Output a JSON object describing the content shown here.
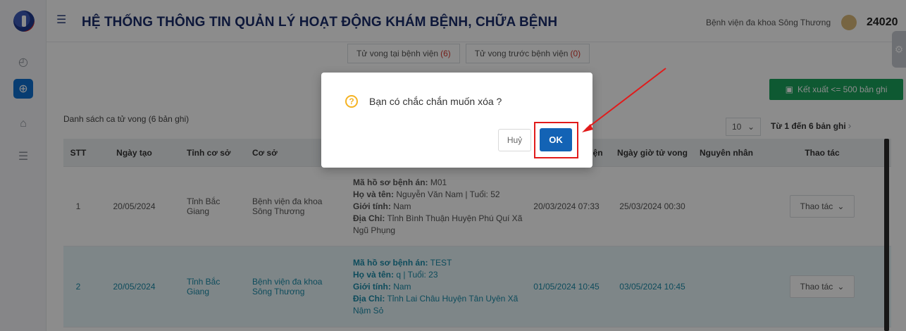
{
  "header": {
    "title": "HỆ THỐNG THÔNG TIN QUẢN LÝ HOẠT ĐỘNG KHÁM BỆNH, CHỮA BỆNH",
    "hospital": "Bệnh viện đa khoa Sông Thương",
    "user_code": "24020",
    "menu_icon": "hamburger-icon",
    "settings_icon": "gear-icon"
  },
  "sidebar": {
    "icons": [
      "logo-icon",
      "dashboard-icon",
      "medical-box-icon",
      "building-icon",
      "list-icon"
    ]
  },
  "tabs": [
    {
      "label": "Tử vong tại bệnh viện",
      "count": "(6)"
    },
    {
      "label": "Tử vong trước bệnh viện",
      "count": "(0)"
    }
  ],
  "toolbar": {
    "export_label": "Kết xuất <= 500 bản ghi",
    "export_icon": "excel-icon",
    "export_color": "#1aa35b"
  },
  "list": {
    "title": "Danh sách ca tử vong (6 bản ghi)",
    "page_size": "10",
    "range": "Từ 1 đến 6 bản ghi"
  },
  "table": {
    "columns": [
      "STT",
      "Ngày tạo",
      "Tỉnh cơ sở",
      "Cơ sở",
      "Ngày giờ vào viện",
      "Ngày giờ tử vong",
      "Nguyên nhân",
      "Thao tác"
    ],
    "rows": [
      {
        "stt": "1",
        "created": "20/05/2024",
        "province": "Tỉnh Bắc Giang",
        "facility": "Bệnh viện đa khoa Sông Thương",
        "record_key": "Mã hồ sơ bệnh án:",
        "record_val": " M01",
        "name_key": "Họ và tên:",
        "name_val": " Nguyễn Văn Nam | Tuổi: 52",
        "gender_key": "Giới tính:",
        "gender_val": " Nam",
        "addr_key": "Địa Chỉ:",
        "addr_val": " Tỉnh Bình Thuận Huyện Phú Quí Xã Ngũ Phụng",
        "admitted": "20/03/2024 07:33",
        "died": "25/03/2024 00:30",
        "cause": "",
        "action": "Thao tác"
      },
      {
        "stt": "2",
        "created": "20/05/2024",
        "province": "Tỉnh Bắc Giang",
        "facility": "Bệnh viện đa khoa Sông Thương",
        "record_key": "Mã hồ sơ bệnh án:",
        "record_val": " TEST",
        "name_key": "Họ và tên:",
        "name_val": " q | Tuổi: 23",
        "gender_key": "Giới tính:",
        "gender_val": " Nam",
        "addr_key": "Địa Chỉ:",
        "addr_val": " Tỉnh Lai Châu Huyện Tân Uyên Xã Nậm Sỏ",
        "admitted": "01/05/2024 10:45",
        "died": "03/05/2024 10:45",
        "cause": "",
        "action": "Thao tác"
      }
    ]
  },
  "dialog": {
    "icon": "question-icon",
    "message": "Bạn có chắc chắn muốn xóa ?",
    "cancel_label": "Huỷ",
    "ok_label": "OK",
    "ok_color": "#1363b5",
    "highlight_color": "#e11b1b"
  }
}
